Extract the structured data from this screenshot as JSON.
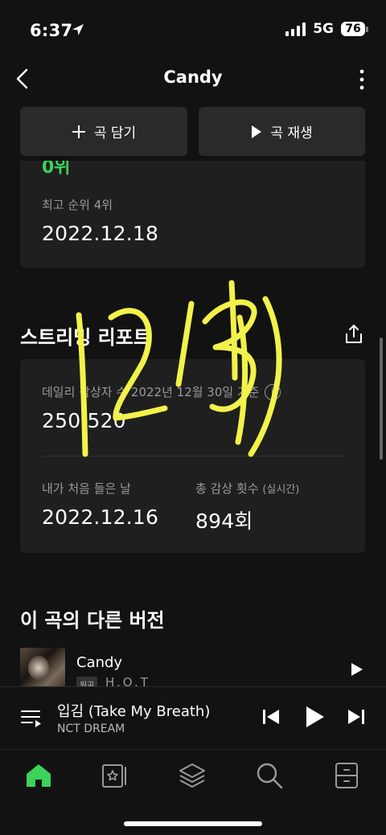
{
  "status_bar": {
    "time": "6:37",
    "network": "5G",
    "battery": "76"
  },
  "navbar": {
    "title": "Candy"
  },
  "actions": {
    "add_label": "곡 담기",
    "play_label": "곡 재생"
  },
  "chart_card": {
    "current_rank_partial": "0위",
    "peak_label": "최고 순위 4위",
    "peak_date": "2022.12.18"
  },
  "streaming_report": {
    "title": "스트리밍 리포트",
    "daily_listeners_label": "데일리 감상자 수  2022년 12월 30일 기준",
    "daily_listeners_value": "250,520",
    "first_listen_label": "내가 처음 들은 날",
    "first_listen_value": "2022.12.16",
    "total_plays_label": "총 감상 횟수",
    "total_plays_sub": "(실시간)",
    "total_plays_value": "894회"
  },
  "other_versions": {
    "title": "이 곡의 다른 버전",
    "items": [
      {
        "title": "Candy",
        "badge": "원곡",
        "artist": "H.O.T"
      }
    ]
  },
  "now_playing": {
    "title": "입김 (Take My Breath)",
    "artist": "NCT DREAM"
  },
  "colors": {
    "accent_green": "#3bd35a",
    "background": "#121212",
    "card": "#1f1f1f",
    "handwriting_yellow": "#f2f24a"
  },
  "icons": {
    "back": "chevron-left-icon",
    "more": "more-vertical-icon",
    "add": "plus-icon",
    "play": "play-icon",
    "share": "share-icon",
    "info": "info-icon",
    "queue": "queue-icon",
    "prev": "skip-previous-icon",
    "next": "skip-next-icon",
    "nav": [
      "home-icon",
      "library-card-icon",
      "layers-icon",
      "search-icon",
      "drawer-icon"
    ]
  },
  "handwritten_annotation": "12/31"
}
